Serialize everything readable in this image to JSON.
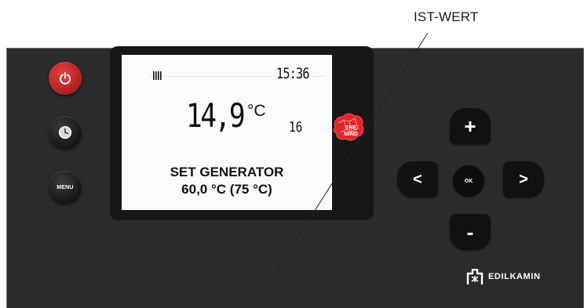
{
  "callout": {
    "label": "IST-WERT"
  },
  "buttons": {
    "power_icon": "power-icon",
    "clock_icon": "clock-icon",
    "menu_label": "MENU"
  },
  "display": {
    "time": "15:36",
    "temperature": "14,9",
    "unit": "°C",
    "small_value": "16",
    "line1": "SET GENERATOR",
    "line2": "60,0 °C (75 °C)"
  },
  "badge": {
    "line1": "THE",
    "line2": "MIND"
  },
  "nav": {
    "plus": "+",
    "minus": "-",
    "left": "<",
    "right": ">",
    "ok": "OK"
  },
  "brand": {
    "name": "EDILKAMIN"
  },
  "colors": {
    "panel": "#2a2b2d",
    "power_red": "#c92a2a",
    "badge_red": "#e0262b",
    "lcd_background": "#fbfbfb"
  }
}
